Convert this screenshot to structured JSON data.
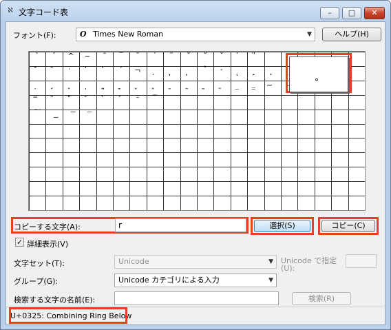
{
  "window": {
    "title": "文字コード表",
    "icon": "character-map-icon",
    "controls": {
      "minimize": "–",
      "maximize": "□",
      "close": "✕"
    }
  },
  "font": {
    "label": "フォント(F):",
    "glyph": "O",
    "value": "Times New Roman"
  },
  "help_button": "ヘルプ(H)",
  "grid": {
    "glyph_rows": [
      [
        "`",
        "´",
        "^",
        "~",
        "¯",
        "‾",
        "˘",
        "˙",
        "¨",
        "˚",
        "˝",
        "ˇ",
        "̍",
        "̎",
        "",
        "",
        "",
        "",
        "",
        ""
      ],
      [
        "̐",
        "̑",
        "̒",
        "̓",
        "̔",
        "̕",
        "¬",
        "̗",
        "̘",
        "̙",
        "̚",
        "̛",
        "̜",
        "̝",
        "̞",
        "̟",
        "̠",
        "",
        "",
        ""
      ],
      [
        "̦",
        "̧",
        "̨",
        "̩",
        "̪",
        "̫",
        "̬",
        "̭",
        "̮",
        "̯",
        "̰",
        "̱",
        "̲",
        "̳",
        "̴",
        "̵",
        "",
        "",
        "",
        ""
      ],
      [
        "̿",
        "̈",
        "̊",
        "̄",
        "̀",
        "́",
        "͂",
        "͡",
        "",
        "",
        "",
        "",
        "",
        "",
        "",
        "",
        "",
        "",
        "",
        ""
      ],
      [
        "͠",
        "͜",
        "͝",
        "͞",
        "",
        "",
        "",
        "",
        "",
        "",
        "",
        "",
        "",
        "",
        "",
        "",
        "",
        "",
        "",
        ""
      ]
    ],
    "magnified_glyph": "̥"
  },
  "copy": {
    "label": "コピーする文字(A):",
    "value": "r",
    "select_button": "選択(S)",
    "copy_button": "コピー(C)"
  },
  "advanced": {
    "checkbox_label": "詳細表示(V)",
    "checked": true,
    "charset_label": "文字セット(T):",
    "charset_value": "Unicode",
    "unicode_goto_label_1": "Unicode で指定",
    "unicode_goto_label_2": "(U):",
    "unicode_goto_value": "",
    "group_label": "グループ(G):",
    "group_value": "Unicode カテゴリによる入力",
    "search_label": "検索する文字の名前(E):",
    "search_value": "",
    "search_button": "検索(R)"
  },
  "status": {
    "text": "U+0325: Combining Ring Below"
  }
}
